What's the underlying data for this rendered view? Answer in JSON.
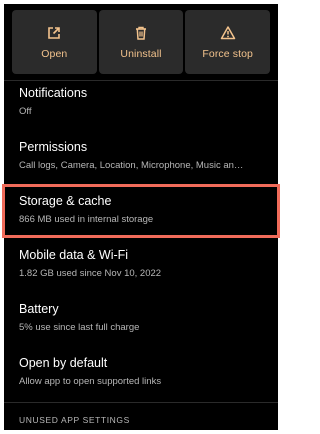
{
  "actions": [
    {
      "label": "Open",
      "icon": "open-external-icon"
    },
    {
      "label": "Uninstall",
      "icon": "trash-icon"
    },
    {
      "label": "Force stop",
      "icon": "warning-icon"
    }
  ],
  "accent_color": "#f3c38d",
  "highlight_color": "#f06b5a",
  "settings": [
    {
      "title": "Notifications",
      "summary": "Off"
    },
    {
      "title": "Permissions",
      "summary": "Call logs, Camera, Location, Microphone, Music an…"
    },
    {
      "title": "Storage & cache",
      "summary": "866 MB used in internal storage"
    },
    {
      "title": "Mobile data & Wi-Fi",
      "summary": "1.82 GB used since Nov 10, 2022"
    },
    {
      "title": "Battery",
      "summary": "5% use since last full charge"
    },
    {
      "title": "Open by default",
      "summary": "Allow app to open supported links"
    }
  ],
  "section_header": "UNUSED APP SETTINGS"
}
